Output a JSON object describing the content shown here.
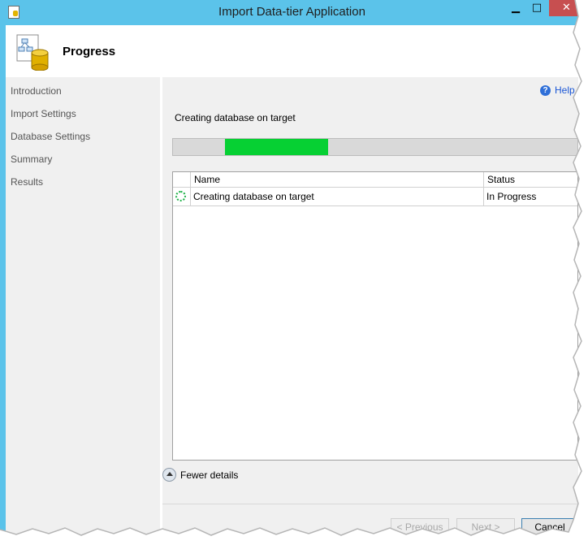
{
  "window": {
    "title": "Import Data-tier Application",
    "controls": {
      "minimize": "▁",
      "maximize": "□",
      "close": "✕"
    }
  },
  "header": {
    "title": "Progress",
    "icon": "database-wizard-icon"
  },
  "sidebar": {
    "items": [
      {
        "label": "Introduction"
      },
      {
        "label": "Import Settings"
      },
      {
        "label": "Database Settings"
      },
      {
        "label": "Summary"
      },
      {
        "label": "Results"
      }
    ]
  },
  "main": {
    "help_label": "Help",
    "help_icon": "help-icon",
    "status_text": "Creating database on target",
    "progress_color": "#06d033",
    "table": {
      "columns": [
        "Name",
        "Status"
      ],
      "rows": [
        {
          "icon": "in-progress-spinner-icon",
          "name": "Creating database on target",
          "status": "In Progress"
        }
      ]
    },
    "toggle_details_label": "Fewer details"
  },
  "footer": {
    "previous_label": "< Previous",
    "next_label": "Next >",
    "cancel_label": "Cancel"
  },
  "colors": {
    "titlebar": "#5bc3ea",
    "close_button": "#c74f50",
    "accent_link": "#1a56d6"
  }
}
